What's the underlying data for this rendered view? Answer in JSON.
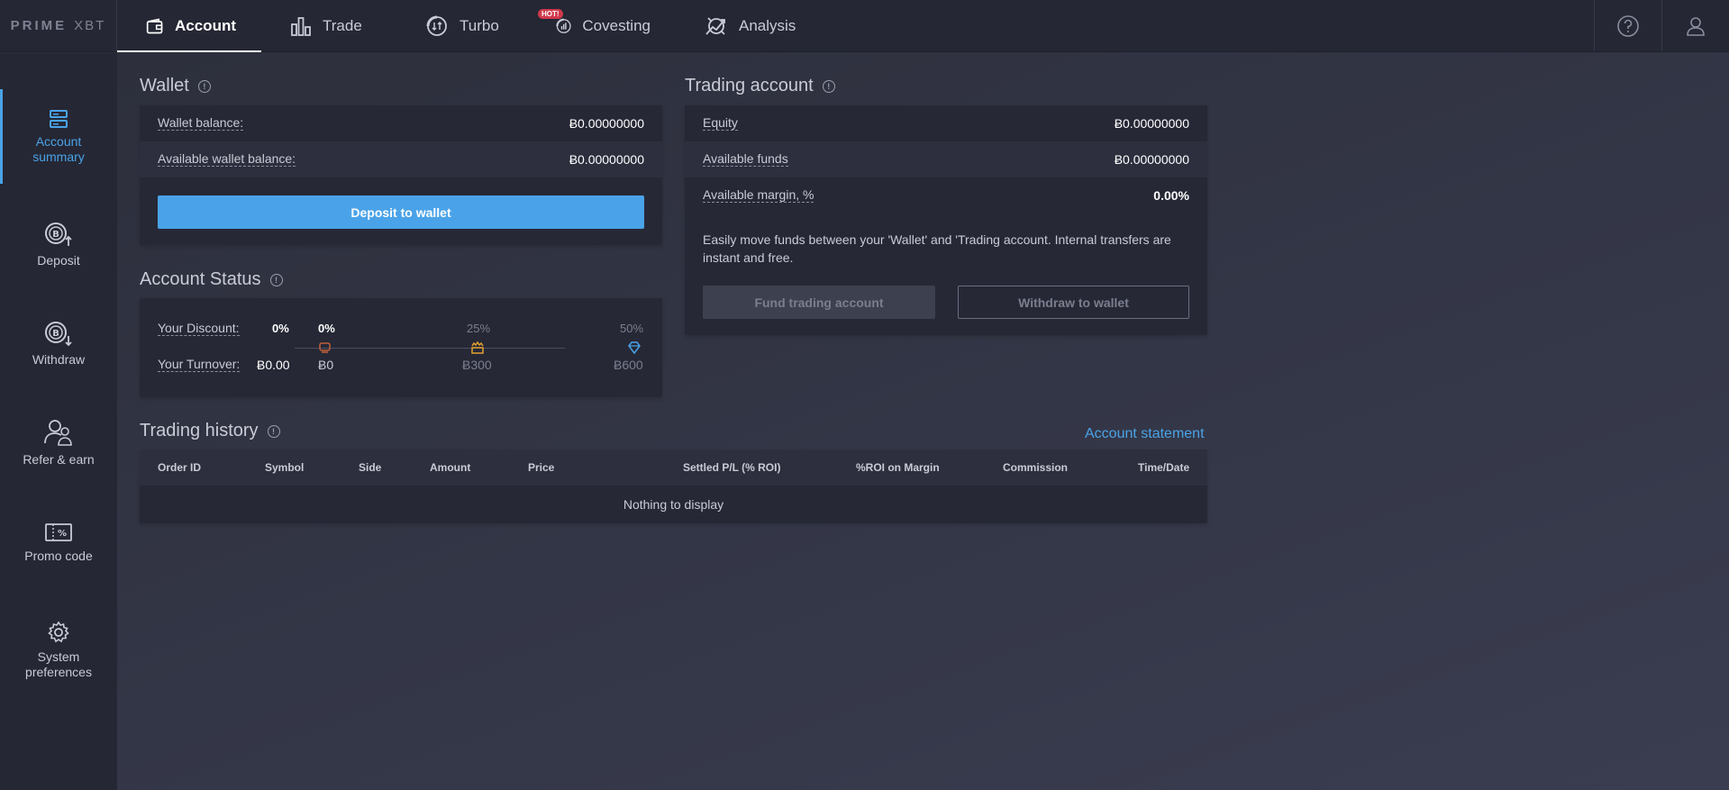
{
  "brand": {
    "logo_main": "PRIME",
    "logo_sub": "XBT"
  },
  "nav": {
    "tabs": [
      {
        "label": "Account",
        "icon": "wallet-icon",
        "active": true
      },
      {
        "label": "Trade",
        "icon": "bar-chart-icon"
      },
      {
        "label": "Turbo",
        "icon": "turbo-icon"
      },
      {
        "label": "Covesting",
        "icon": "covesting-icon",
        "badge": "HOT!"
      },
      {
        "label": "Analysis",
        "icon": "analysis-icon"
      }
    ],
    "help_icon": "help-icon",
    "user_icon": "user-icon"
  },
  "sidebar": {
    "items": [
      {
        "label_line1": "Account",
        "label_line2": "summary",
        "icon": "account-summary-icon",
        "active": true
      },
      {
        "label_line1": "Deposit",
        "label_line2": "",
        "icon": "deposit-icon"
      },
      {
        "label_line1": "Withdraw",
        "label_line2": "",
        "icon": "withdraw-icon"
      },
      {
        "label_line1": "Refer & earn",
        "label_line2": "",
        "icon": "refer-icon"
      },
      {
        "label_line1": "Promo code",
        "label_line2": "",
        "icon": "promo-code-icon"
      },
      {
        "label_line1": "System",
        "label_line2": "preferences",
        "icon": "gear-icon"
      }
    ]
  },
  "wallet": {
    "title": "Wallet",
    "balance_label": "Wallet balance:",
    "balance_value": "Ƀ0.00000000",
    "available_label": "Available wallet balance:",
    "available_value": "Ƀ0.00000000",
    "deposit_button": "Deposit to wallet"
  },
  "trading_account": {
    "title": "Trading account",
    "equity_label": "Equity",
    "equity_value": "Ƀ0.00000000",
    "funds_label": "Available funds",
    "funds_value": "Ƀ0.00000000",
    "margin_label": "Available margin, %",
    "margin_value": "0.00%",
    "note": "Easily move funds between your 'Wallet' and 'Trading account. Internal transfers are instant and free.",
    "fund_button": "Fund trading account",
    "withdraw_button": "Withdraw to wallet"
  },
  "account_status": {
    "title": "Account Status",
    "discount_label": "Your Discount:",
    "discount_value": "0%",
    "turnover_label": "Your Turnover:",
    "turnover_value": "Ƀ0.00",
    "tiers": [
      {
        "pct": "0%",
        "amount": "Ƀ0",
        "icon": "bronze-tier-icon",
        "color": "#c0603a"
      },
      {
        "pct": "25%",
        "amount": "Ƀ300",
        "icon": "gold-tier-icon",
        "color": "#e0a030"
      },
      {
        "pct": "50%",
        "amount": "Ƀ600",
        "icon": "diamond-tier-icon",
        "color": "#4aa3e8"
      }
    ]
  },
  "trading_history": {
    "title": "Trading history",
    "statement_link": "Account statement",
    "columns": [
      "Order ID",
      "Symbol",
      "Side",
      "Amount",
      "Price",
      "Settled P/L (% ROI)",
      "%ROI on Margin",
      "Commission",
      "Time/Date"
    ],
    "empty_text": "Nothing to display"
  },
  "colors": {
    "accent": "#4aa3e8",
    "badge": "#d0384b"
  }
}
